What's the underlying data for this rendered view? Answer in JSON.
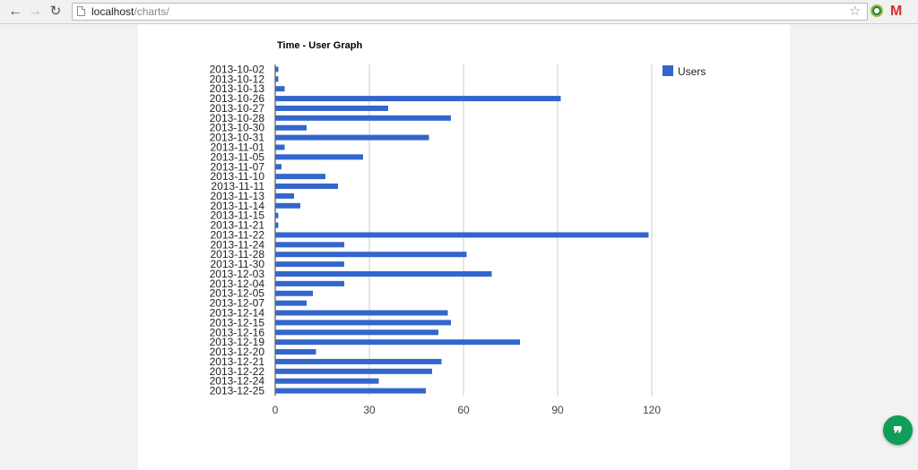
{
  "browser": {
    "back_icon": "arrow-left-icon",
    "forward_icon": "arrow-right-icon",
    "reload_icon": "reload-icon",
    "url_host": "localhost",
    "url_path": "/charts/",
    "bookmark_icon": "star-icon",
    "extension_icon": "extension-icon",
    "gmail_icon": "gmail-icon",
    "gmail_letter": "M"
  },
  "hangouts": {
    "icon": "quote-icon",
    "glyph": "❞"
  },
  "chart_data": {
    "type": "bar",
    "orientation": "horizontal",
    "title": "Time - User Graph",
    "xlabel": "",
    "ylabel": "",
    "xlim": [
      0,
      120
    ],
    "xticks": [
      0,
      30,
      60,
      90,
      120
    ],
    "grid": true,
    "legend_position": "top-right",
    "categories": [
      "2013-10-02",
      "2013-10-12",
      "2013-10-13",
      "2013-10-26",
      "2013-10-27",
      "2013-10-28",
      "2013-10-30",
      "2013-10-31",
      "2013-11-01",
      "2013-11-05",
      "2013-11-07",
      "2013-11-10",
      "2013-11-11",
      "2013-11-13",
      "2013-11-14",
      "2013-11-15",
      "2013-11-21",
      "2013-11-22",
      "2013-11-24",
      "2013-11-28",
      "2013-11-30",
      "2013-12-03",
      "2013-12-04",
      "2013-12-05",
      "2013-12-07",
      "2013-12-14",
      "2013-12-15",
      "2013-12-16",
      "2013-12-19",
      "2013-12-20",
      "2013-12-21",
      "2013-12-22",
      "2013-12-24",
      "2013-12-25"
    ],
    "series": [
      {
        "name": "Users",
        "color": "#3366cc",
        "values": [
          1,
          1,
          3,
          91,
          36,
          56,
          10,
          49,
          3,
          28,
          2,
          16,
          20,
          6,
          8,
          1,
          1,
          119,
          22,
          61,
          22,
          69,
          22,
          12,
          10,
          55,
          56,
          52,
          78,
          13,
          53,
          50,
          33,
          48
        ]
      }
    ]
  }
}
